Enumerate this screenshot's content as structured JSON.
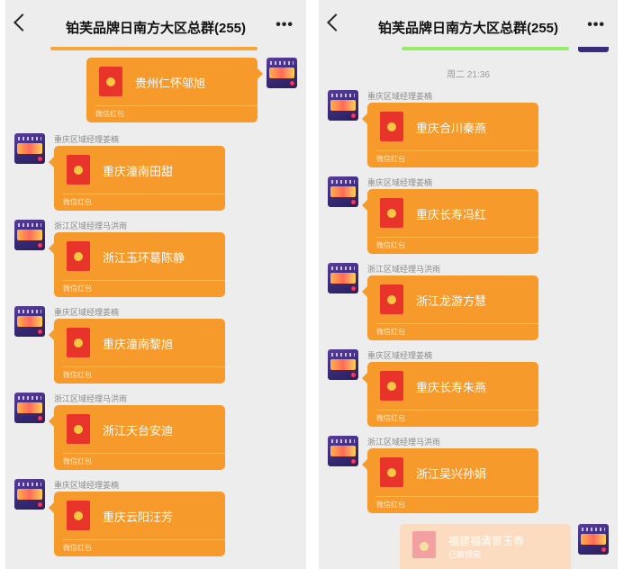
{
  "left": {
    "title": "铂芙品牌日南方大区总群(255)",
    "messages": [
      {
        "sender": "",
        "name": "贵州仁怀邬旭",
        "footer": "微信红包"
      },
      {
        "sender": "重庆区域经理姜楠",
        "name": "重庆潼南田甜",
        "footer": "微信红包"
      },
      {
        "sender": "浙江区域经理马洪雨",
        "name": "浙江玉环葛陈静",
        "footer": "微信红包"
      },
      {
        "sender": "重庆区域经理姜楠",
        "name": "重庆潼南黎旭",
        "footer": "微信红包"
      },
      {
        "sender": "浙江区域经理马洪雨",
        "name": "浙江天台安迪",
        "footer": "微信红包"
      },
      {
        "sender": "重庆区域经理姜楠",
        "name": "重庆云阳汪芳",
        "footer": "微信红包"
      }
    ]
  },
  "right": {
    "title": "铂芙品牌日南方大区总群(255)",
    "timestamp": "周二 21:36",
    "messages": [
      {
        "sender": "重庆区域经理姜楠",
        "name": "重庆合川秦燕",
        "footer": "微信红包"
      },
      {
        "sender": "重庆区域经理姜楠",
        "name": "重庆长寿冯红",
        "footer": "微信红包"
      },
      {
        "sender": "浙江区域经理马洪雨",
        "name": "浙江龙游方慧",
        "footer": "微信红包"
      },
      {
        "sender": "重庆区域经理姜楠",
        "name": "重庆长寿朱燕",
        "footer": "微信红包"
      },
      {
        "sender": "浙江区域经理马洪雨",
        "name": "浙江吴兴孙娟",
        "footer": "微信红包"
      }
    ],
    "opened": {
      "name": "福建福清曾玉春",
      "status": "已被领完"
    }
  },
  "colors": {
    "bubble": "#f79a2c",
    "envelope": "#e8342a",
    "green": "#95ec69"
  }
}
